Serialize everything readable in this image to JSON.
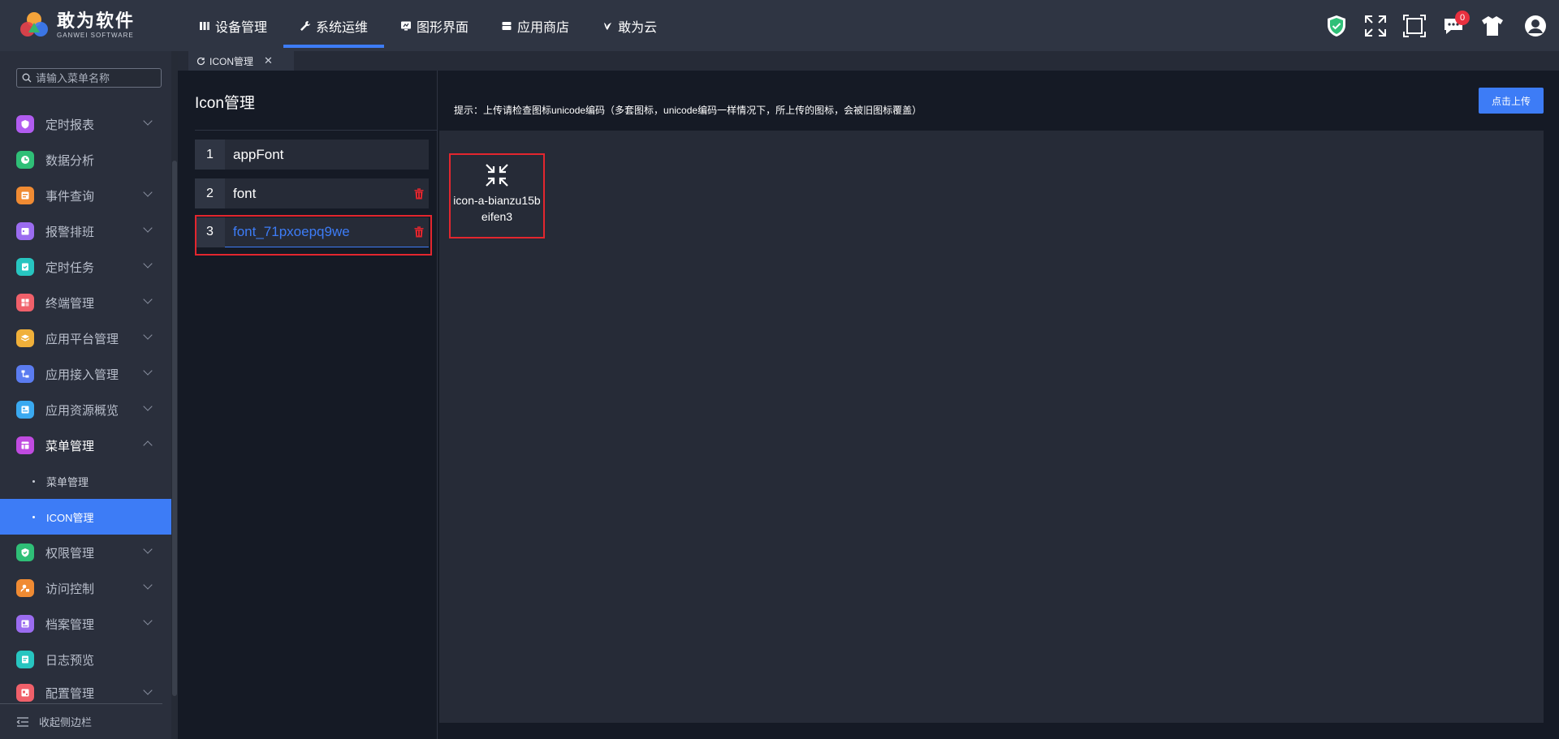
{
  "brand": {
    "title": "敢为软件",
    "subtitle": "GANWEI SOFTWARE"
  },
  "topnav": [
    {
      "label": "设备管理",
      "icon": "device-icon"
    },
    {
      "label": "系统运维",
      "icon": "wrench-icon",
      "active": true
    },
    {
      "label": "图形界面",
      "icon": "monitor-icon"
    },
    {
      "label": "应用商店",
      "icon": "store-icon"
    },
    {
      "label": "敢为云",
      "icon": "cloud-bird-icon"
    }
  ],
  "topright": {
    "notification_count": "0",
    "icons": [
      "shield-check-icon",
      "fullscreen-icon",
      "frame-icon",
      "message-icon",
      "shirt-icon",
      "user-avatar-icon"
    ]
  },
  "sidebar": {
    "search_placeholder": "请输入菜单名称",
    "items": [
      {
        "label": "定时报表",
        "color": "#b15cf0",
        "expandable": true
      },
      {
        "label": "数据分析",
        "color": "#2fbf77",
        "expandable": false
      },
      {
        "label": "事件查询",
        "color": "#f08b33",
        "expandable": true
      },
      {
        "label": "报警排班",
        "color": "#9b6cf0",
        "expandable": true
      },
      {
        "label": "定时任务",
        "color": "#27c5c0",
        "expandable": true
      },
      {
        "label": "终端管理",
        "color": "#f0606a",
        "expandable": true
      },
      {
        "label": "应用平台管理",
        "color": "#f0b03a",
        "expandable": true
      },
      {
        "label": "应用接入管理",
        "color": "#5b7cf0",
        "expandable": true
      },
      {
        "label": "应用资源概览",
        "color": "#3aa9f0",
        "expandable": true
      },
      {
        "label": "菜单管理",
        "color": "#c04be0",
        "expandable": true,
        "open": true
      },
      {
        "label": "权限管理",
        "color": "#2fbf77",
        "expandable": true
      },
      {
        "label": "访问控制",
        "color": "#f08b33",
        "expandable": true
      },
      {
        "label": "档案管理",
        "color": "#9b6cf0",
        "expandable": true
      },
      {
        "label": "日志预览",
        "color": "#27c5c0",
        "expandable": false
      },
      {
        "label": "配置管理",
        "color": "#f0606a",
        "expandable": true
      }
    ],
    "sub_items": [
      {
        "label": "菜单管理"
      },
      {
        "label": "ICON管理",
        "active": true
      }
    ],
    "collapse_label": "收起侧边栏"
  },
  "tabs": [
    {
      "label": "ICON管理"
    }
  ],
  "main": {
    "title": "Icon管理",
    "hint": "提示：上传请检查图标unicode编码（多套图标，unicode编码一样情况下，所上传的图标，会被旧图标覆盖）",
    "upload_label": "点击上传",
    "fonts": [
      {
        "index": "1",
        "name": "appFont",
        "deletable": false
      },
      {
        "index": "2",
        "name": "font",
        "deletable": true
      },
      {
        "index": "3",
        "name": "font_71pxoepq9we",
        "deletable": true,
        "selected": true
      }
    ],
    "icons": [
      {
        "name": "icon-a-bianzu15beifen3",
        "glyph": "compress-arrows-icon"
      }
    ]
  },
  "colors": {
    "accent": "#3d7cf6",
    "danger": "#e3262e",
    "topbar": "#2f3543",
    "panel": "#151a25"
  }
}
